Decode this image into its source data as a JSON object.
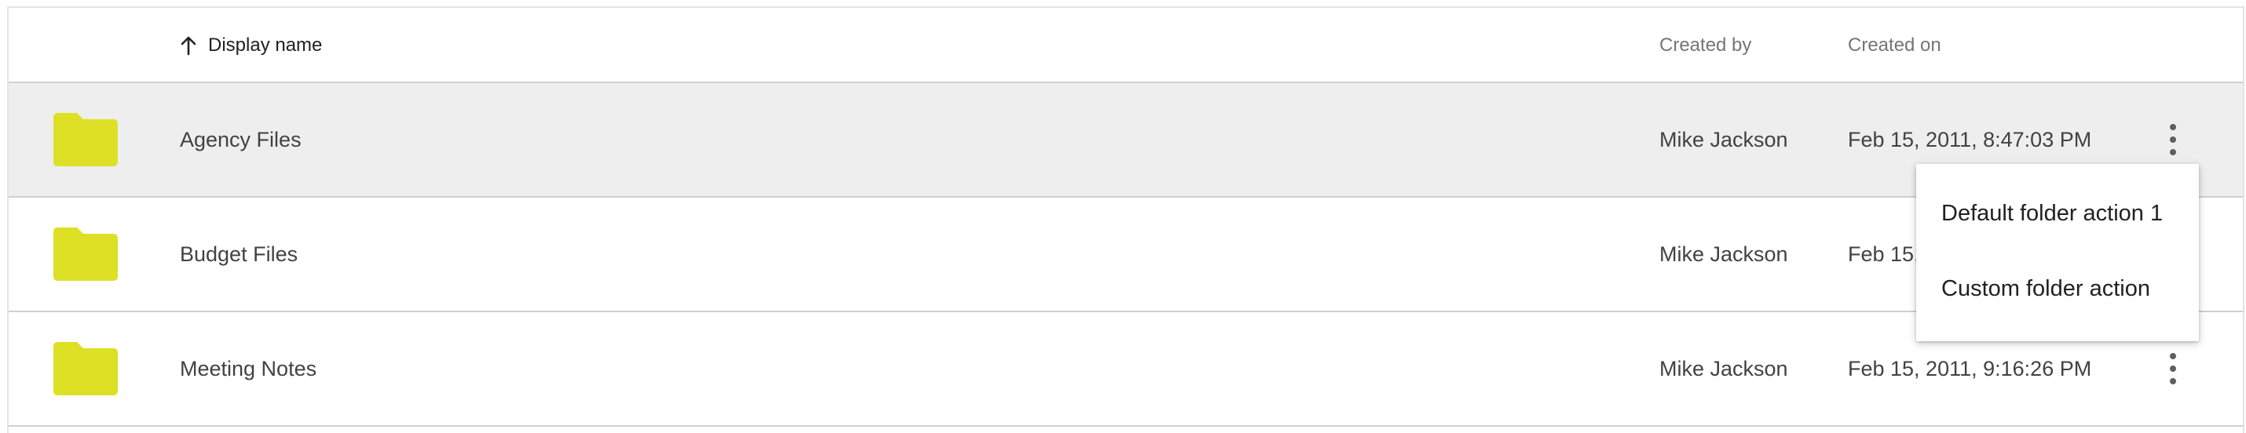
{
  "header": {
    "sort_icon": "arrow-up-icon",
    "display_name": "Display name",
    "created_by": "Created by",
    "created_on": "Created on"
  },
  "rows": [
    {
      "icon": "folder-icon",
      "name": "Agency Files",
      "created_by": "Mike Jackson",
      "created_on": "Feb 15, 2011, 8:47:03 PM",
      "selected": true
    },
    {
      "icon": "folder-icon",
      "name": "Budget Files",
      "created_by": "Mike Jackson",
      "created_on": "Feb 15,",
      "selected": false
    },
    {
      "icon": "folder-icon",
      "name": "Meeting Notes",
      "created_by": "Mike Jackson",
      "created_on": "Feb 15, 2011, 9:16:26 PM",
      "selected": false
    }
  ],
  "context_menu": {
    "items": [
      "Default folder action 1",
      "Custom folder action"
    ]
  },
  "colors": {
    "folder": "#dde024",
    "selected_row": "#eeeeee",
    "kebab": "#5f5f5f"
  }
}
